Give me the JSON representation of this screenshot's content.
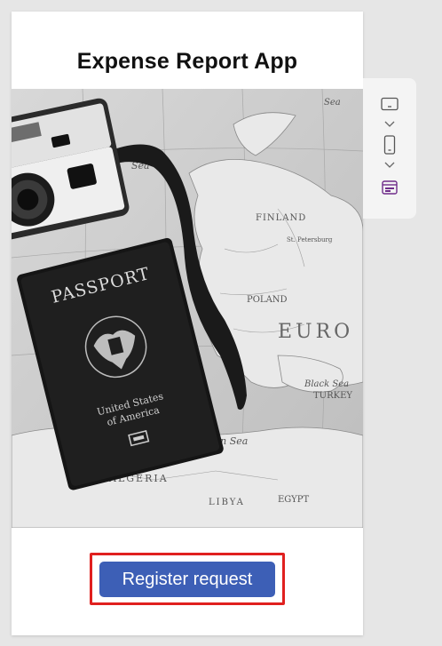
{
  "app": {
    "title": "Expense Report App",
    "register_button_label": "Register request",
    "accent_color": "#3d5fb6",
    "highlight_color": "#e0201f"
  },
  "hero": {
    "icon": "travel-photo",
    "passport_text": "PASSPORT",
    "passport_country_line1": "United States",
    "passport_country_line2": "of America",
    "map_labels": [
      "Sea",
      "FINLAND",
      "St. Petersburg",
      "POLAND",
      "EUROPE",
      "TURKEY",
      "Black Sea",
      "ALGERIA",
      "LIBYA",
      "EGYPT",
      "Mediterranean Sea"
    ]
  },
  "toolbar": {
    "items": [
      {
        "icon": "tablet-landscape-icon"
      },
      {
        "icon": "chevron-down-icon"
      },
      {
        "icon": "phone-portrait-icon"
      },
      {
        "icon": "chevron-down-icon"
      },
      {
        "icon": "screen-layout-icon"
      }
    ]
  }
}
